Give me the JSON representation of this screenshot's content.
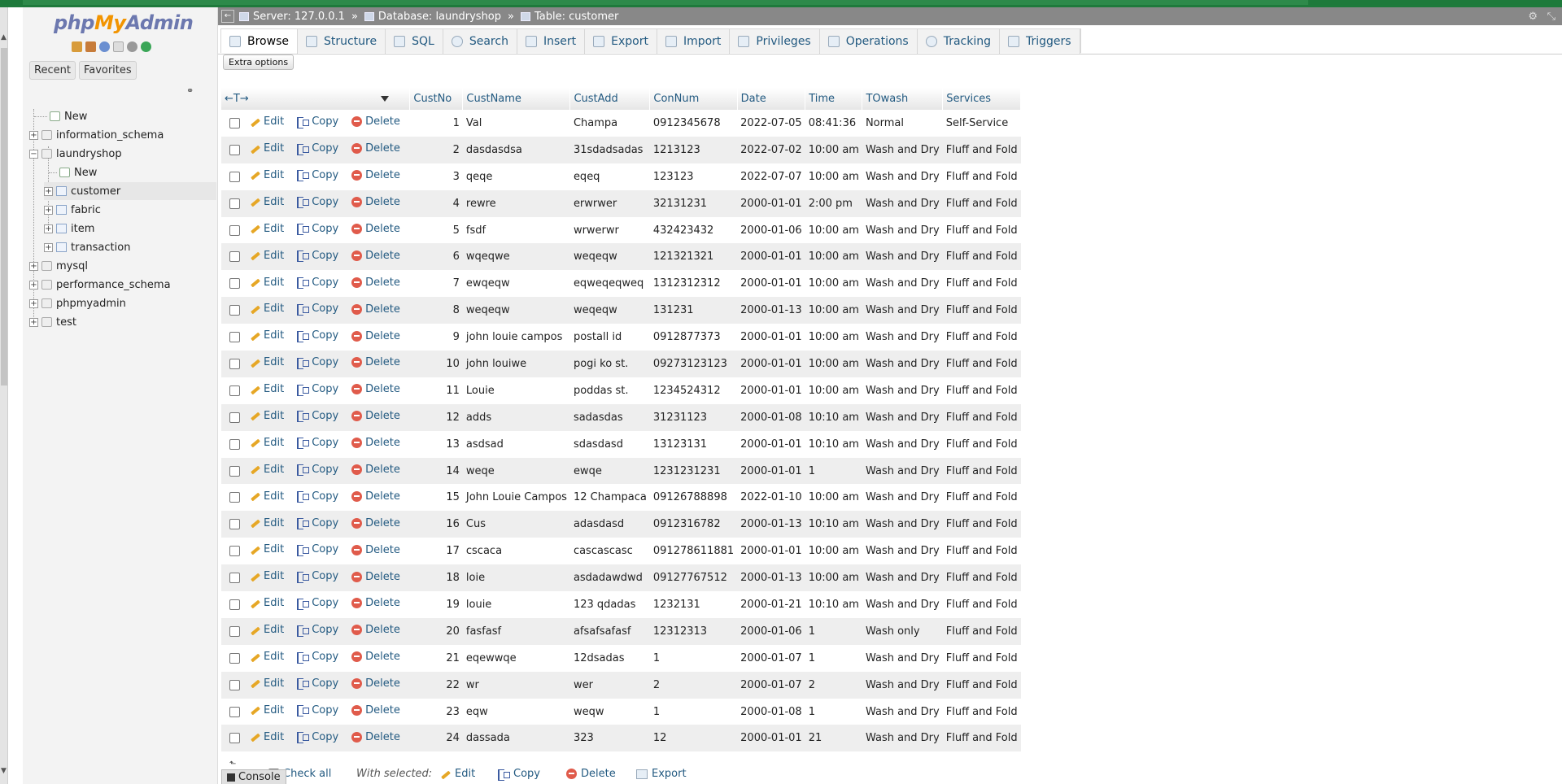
{
  "nav": {
    "logo": {
      "php": "php",
      "my": "My",
      "admin": "Admin"
    },
    "tabs": [
      "Recent",
      "Favorites"
    ],
    "tree": [
      {
        "label": "New",
        "level": 0,
        "kind": "new"
      },
      {
        "label": "information_schema",
        "level": 0,
        "kind": "db"
      },
      {
        "label": "laundryshop",
        "level": 0,
        "kind": "db-open"
      },
      {
        "label": "New",
        "level": 1,
        "kind": "new"
      },
      {
        "label": "customer",
        "level": 1,
        "kind": "table",
        "active": true
      },
      {
        "label": "fabric",
        "level": 1,
        "kind": "table"
      },
      {
        "label": "item",
        "level": 1,
        "kind": "table"
      },
      {
        "label": "transaction",
        "level": 1,
        "kind": "table"
      },
      {
        "label": "mysql",
        "level": 0,
        "kind": "db"
      },
      {
        "label": "performance_schema",
        "level": 0,
        "kind": "db"
      },
      {
        "label": "phpmyadmin",
        "level": 0,
        "kind": "db"
      },
      {
        "label": "test",
        "level": 0,
        "kind": "db"
      }
    ]
  },
  "breadcrumb": {
    "server": "Server: 127.0.0.1",
    "database": "Database: laundryshop",
    "table": "Table: customer",
    "separator": "»"
  },
  "menu": {
    "tabs": [
      {
        "label": "Browse",
        "active": true
      },
      {
        "label": "Structure"
      },
      {
        "label": "SQL"
      },
      {
        "label": "Search"
      },
      {
        "label": "Insert"
      },
      {
        "label": "Export"
      },
      {
        "label": "Import"
      },
      {
        "label": "Privileges"
      },
      {
        "label": "Operations"
      },
      {
        "label": "Tracking"
      },
      {
        "label": "Triggers"
      }
    ]
  },
  "extra_options": "Extra options",
  "table": {
    "header_arrows": "←T→",
    "columns": [
      "CustNo",
      "CustName",
      "CustAdd",
      "ConNum",
      "Date",
      "Time",
      "TOwash",
      "Services"
    ],
    "actions": {
      "edit": "Edit",
      "copy": "Copy",
      "delete": "Delete"
    },
    "rows": [
      [
        "1",
        "Val",
        "Champa",
        "0912345678",
        "2022-07-05",
        "08:41:36",
        "Normal",
        "Self-Service"
      ],
      [
        "2",
        "dasdasdsa",
        "31sdadsadas",
        "1213123",
        "2022-07-02",
        "10:00 am",
        "Wash and Dry",
        "Fluff and Fold"
      ],
      [
        "3",
        "qeqe",
        "eqeq",
        "123123",
        "2022-07-07",
        "10:00 am",
        "Wash and Dry",
        "Fluff and Fold"
      ],
      [
        "4",
        "rewre",
        "erwrwer",
        "32131231",
        "2000-01-01",
        "2:00 pm",
        "Wash and Dry",
        "Fluff and Fold"
      ],
      [
        "5",
        "fsdf",
        "wrwerwr",
        "432423432",
        "2000-01-06",
        "10:00 am",
        "Wash and Dry",
        "Fluff and Fold"
      ],
      [
        "6",
        "wqeqwe",
        "weqeqw",
        "121321321",
        "2000-01-01",
        "10:00 am",
        "Wash and Dry",
        "Fluff and Fold"
      ],
      [
        "7",
        "ewqeqw",
        "eqweqeqweq",
        "1312312312",
        "2000-01-01",
        "10:00 am",
        "Wash and Dry",
        "Fluff and Fold"
      ],
      [
        "8",
        "weqeqw",
        "weqeqw",
        "131231",
        "2000-01-13",
        "10:00 am",
        "Wash and Dry",
        "Fluff and Fold"
      ],
      [
        "9",
        "john louie campos",
        "postall id",
        "0912877373",
        "2000-01-01",
        "10:00 am",
        "Wash and Dry",
        "Fluff and Fold"
      ],
      [
        "10",
        "john louiwe",
        "pogi ko st.",
        "09273123123",
        "2000-01-01",
        "10:00 am",
        "Wash and Dry",
        "Fluff and Fold"
      ],
      [
        "11",
        "Louie",
        "poddas st.",
        "1234524312",
        "2000-01-01",
        "10:00 am",
        "Wash and Dry",
        "Fluff and Fold"
      ],
      [
        "12",
        "adds",
        "sadasdas",
        "31231123",
        "2000-01-08",
        "10:10 am",
        "Wash and Dry",
        "Fluff and Fold"
      ],
      [
        "13",
        "asdsad",
        "sdasdasd",
        "13123131",
        "2000-01-01",
        "10:10 am",
        "Wash and Dry",
        "Fluff and Fold"
      ],
      [
        "14",
        "weqe",
        "ewqe",
        "1231231231",
        "2000-01-01",
        "1",
        "Wash and Dry",
        "Fluff and Fold"
      ],
      [
        "15",
        "John Louie Campos",
        "12 Champaca",
        "09126788898",
        "2022-01-10",
        "10:00 am",
        "Wash and Dry",
        "Fluff and Fold"
      ],
      [
        "16",
        "Cus",
        "adasdasd",
        "0912316782",
        "2000-01-13",
        "10:10 am",
        "Wash and Dry",
        "Fluff and Fold"
      ],
      [
        "17",
        "cscaca",
        "cascascasc",
        "091278611881",
        "2000-01-01",
        "10:00 am",
        "Wash and Dry",
        "Fluff and Fold"
      ],
      [
        "18",
        "loie",
        "asdadawdwd",
        "09127767512",
        "2000-01-13",
        "10:00 am",
        "Wash and Dry",
        "Fluff and Fold"
      ],
      [
        "19",
        "louie",
        "123 qdadas",
        "1232131",
        "2000-01-21",
        "10:10 am",
        "Wash and Dry",
        "Fluff and Fold"
      ],
      [
        "20",
        "fasfasf",
        "afsafsafasf",
        "12312313",
        "2000-01-06",
        "1",
        "Wash only",
        "Fluff and Fold"
      ],
      [
        "21",
        "eqewwqe",
        "12dsadas",
        "1",
        "2000-01-07",
        "1",
        "Wash and Dry",
        "Fluff and Fold"
      ],
      [
        "22",
        "wr",
        "wer",
        "2",
        "2000-01-07",
        "2",
        "Wash and Dry",
        "Fluff and Fold"
      ],
      [
        "23",
        "eqw",
        "weqw",
        "1",
        "2000-01-08",
        "1",
        "Wash and Dry",
        "Fluff and Fold"
      ],
      [
        "24",
        "dassada",
        "323",
        "12",
        "2000-01-01",
        "21",
        "Wash and Dry",
        "Fluff and Fold"
      ]
    ]
  },
  "bottom": {
    "check_all": "Check all",
    "with_selected": "With selected:",
    "edit": "Edit",
    "copy": "Copy",
    "delete": "Delete",
    "export": "Export",
    "console": "Console"
  }
}
